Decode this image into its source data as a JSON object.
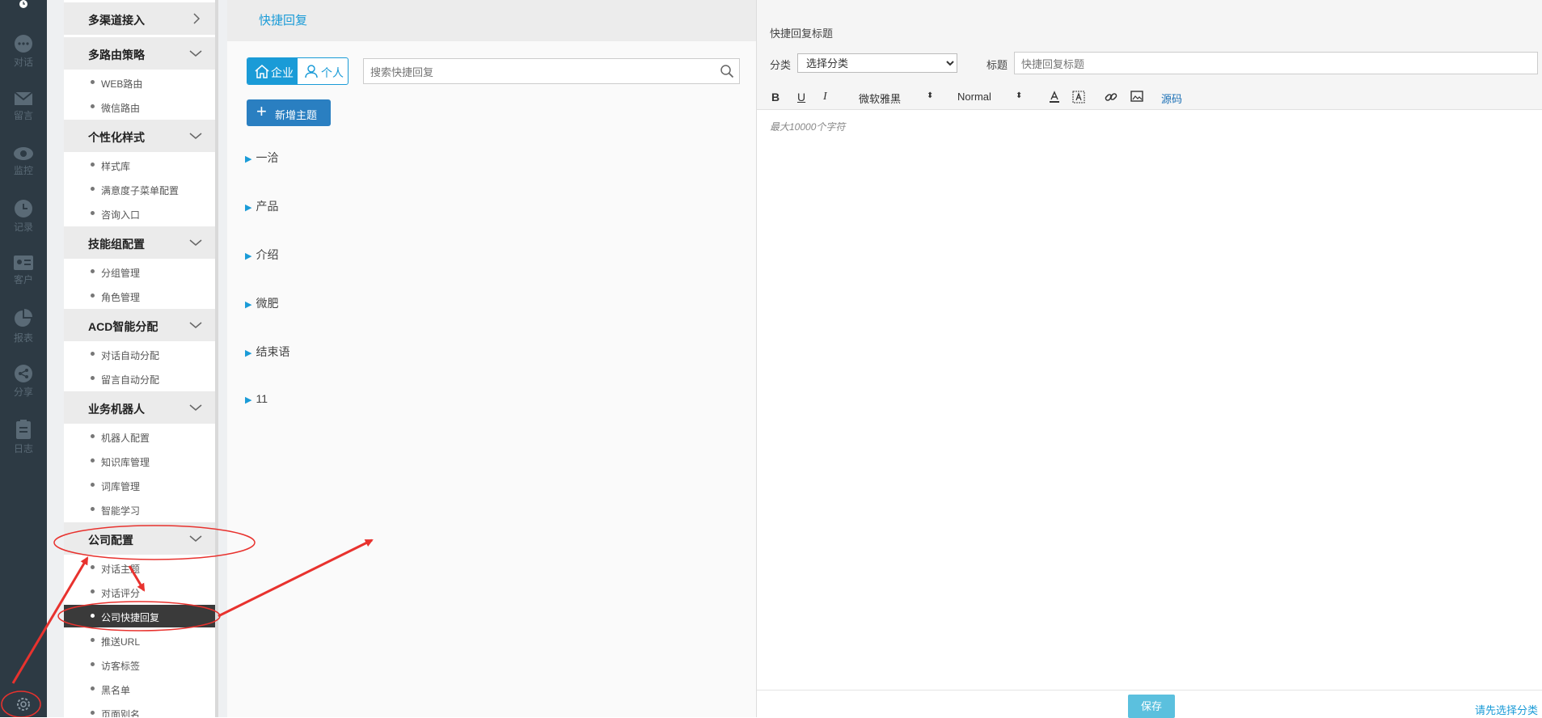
{
  "rail": {
    "items": [
      {
        "icon": "chat-icon",
        "label": "对话"
      },
      {
        "icon": "mail-icon",
        "label": "留言"
      },
      {
        "icon": "eye-icon",
        "label": "监控"
      },
      {
        "icon": "clock-icon",
        "label": "记录"
      },
      {
        "icon": "id-card-icon",
        "label": "客户"
      },
      {
        "icon": "pie-chart-icon",
        "label": "报表"
      },
      {
        "icon": "share-icon",
        "label": "分享"
      },
      {
        "icon": "clipboard-icon",
        "label": "日志"
      }
    ],
    "settings_icon": "gear-icon"
  },
  "menu": {
    "groups": [
      {
        "label": "多渠道接入",
        "expanded": false
      },
      {
        "label": "多路由策略",
        "expanded": true,
        "items": [
          "WEB路由",
          "微信路由"
        ]
      },
      {
        "label": "个性化样式",
        "expanded": true,
        "items": [
          "样式库",
          "满意度子菜单配置",
          "咨询入口"
        ]
      },
      {
        "label": "技能组配置",
        "expanded": true,
        "items": [
          "分组管理",
          "角色管理"
        ]
      },
      {
        "label": "ACD智能分配",
        "expanded": true,
        "items": [
          "对话自动分配",
          "留言自动分配"
        ]
      },
      {
        "label": "业务机器人",
        "expanded": true,
        "items": [
          "机器人配置",
          "知识库管理",
          "词库管理",
          "智能学习"
        ]
      },
      {
        "label": "公司配置",
        "expanded": true,
        "items": [
          "对话主题",
          "对话评分",
          "公司快捷回复",
          "推送URL",
          "访客标签",
          "黑名单",
          "页面别名"
        ]
      }
    ],
    "active_item": "公司快捷回复"
  },
  "middle": {
    "title": "快捷回复",
    "scope_tabs": [
      {
        "label": "企业",
        "icon": "home-icon",
        "selected": true
      },
      {
        "label": "个人",
        "icon": "user-icon",
        "selected": false
      }
    ],
    "search_placeholder": "搜索快捷回复",
    "add_button": "新增主题",
    "tree": [
      "一洽",
      "产品",
      "介绍",
      "微肥",
      "结束语",
      "11"
    ]
  },
  "editor": {
    "caption": "快捷回复标题",
    "category_label": "分类",
    "category_value": "选择分类",
    "title_label": "标题",
    "title_placeholder": "快捷回复标题",
    "toolbar": {
      "bold": "B",
      "underline": "U",
      "italic": "I",
      "font": "微软雅黑",
      "size": "Normal",
      "source": "源码"
    },
    "placeholder": "最大10000个字符",
    "save_button": "保存",
    "hint": "请先选择分类"
  },
  "colors": {
    "rail_bg": "#2d3a44",
    "accent": "#1a9bd7",
    "primary_button": "#2a7fc1",
    "annotation": "#e8322e"
  }
}
